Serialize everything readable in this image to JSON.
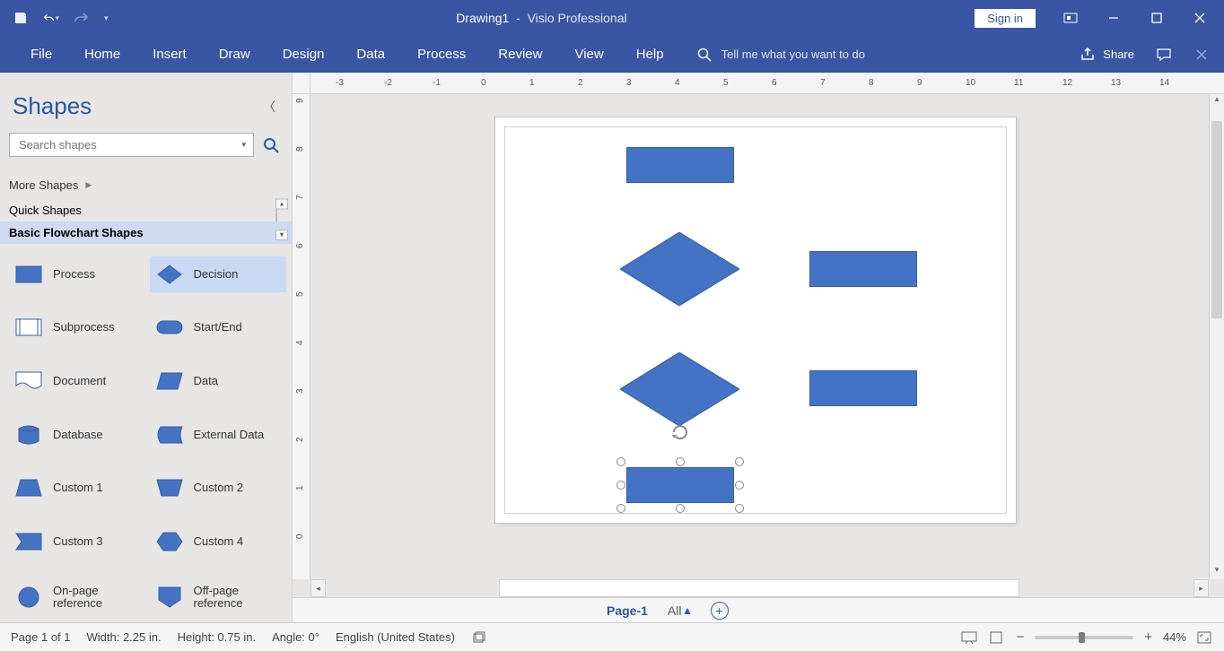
{
  "title": {
    "doc": "Drawing1",
    "app": "Visio Professional"
  },
  "signin": "Sign in",
  "ribbon": {
    "tabs": [
      "File",
      "Home",
      "Insert",
      "Draw",
      "Design",
      "Data",
      "Process",
      "Review",
      "View",
      "Help"
    ],
    "tellme": "Tell me what you want to do",
    "share": "Share"
  },
  "shapes_pane": {
    "title": "Shapes",
    "search_placeholder": "Search shapes",
    "more": "More Shapes",
    "quick": "Quick Shapes",
    "basic": "Basic Flowchart Shapes",
    "items": [
      {
        "label": "Process",
        "type": "rect"
      },
      {
        "label": "Decision",
        "type": "diamond"
      },
      {
        "label": "Subprocess",
        "type": "subproc"
      },
      {
        "label": "Start/End",
        "type": "startend"
      },
      {
        "label": "Document",
        "type": "document"
      },
      {
        "label": "Data",
        "type": "data"
      },
      {
        "label": "Database",
        "type": "database"
      },
      {
        "label": "External Data",
        "type": "extdata"
      },
      {
        "label": "Custom 1",
        "type": "custom1"
      },
      {
        "label": "Custom 2",
        "type": "custom2"
      },
      {
        "label": "Custom 3",
        "type": "custom3"
      },
      {
        "label": "Custom 4",
        "type": "custom4"
      },
      {
        "label": "On-page reference",
        "type": "onpage"
      },
      {
        "label": "Off-page reference",
        "type": "offpage"
      }
    ]
  },
  "ruler_h": [
    "-3",
    "-2",
    "-1",
    "0",
    "1",
    "2",
    "3",
    "4",
    "5",
    "6",
    "7",
    "8",
    "9",
    "10",
    "11",
    "12",
    "13",
    "14"
  ],
  "ruler_v": [
    "9",
    "8",
    "7",
    "6",
    "5",
    "4",
    "3",
    "2",
    "1",
    "0"
  ],
  "page_tabs": {
    "page": "Page-1",
    "all": "All"
  },
  "status": {
    "page": "Page 1 of 1",
    "width": "Width: 2.25 in.",
    "height": "Height: 0.75 in.",
    "angle": "Angle: 0°",
    "lang": "English (United States)",
    "zoom": "44%"
  }
}
